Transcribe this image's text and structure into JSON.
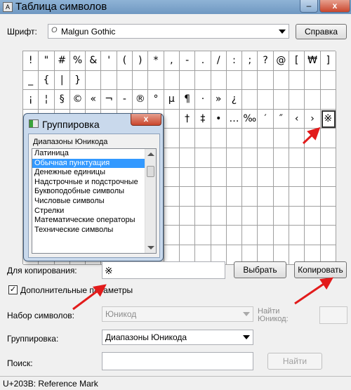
{
  "window": {
    "title": "Таблица символов",
    "minimize_label": "–",
    "close_label": "x"
  },
  "font_row": {
    "label": "Шрифт:",
    "font_icon": "O",
    "value": "Malgun Gothic",
    "help_button": "Справка"
  },
  "grid_rows": [
    [
      "!",
      "\"",
      "#",
      "%",
      "&",
      "'",
      "(",
      ")",
      "*",
      ",",
      "-",
      ".",
      "/",
      ":",
      ";",
      "?",
      "@",
      "[",
      "₩",
      "]"
    ],
    [
      "_",
      "{",
      "|",
      "}",
      "",
      "",
      "",
      "",
      "",
      "",
      "",
      "",
      "",
      "",
      "",
      "",
      "",
      "",
      "",
      ""
    ],
    [
      "¡",
      "¦",
      "§",
      "©",
      "«",
      "¬",
      "-",
      "®",
      "°",
      "µ",
      "¶",
      "·",
      "»",
      "¿",
      "",
      "",
      "",
      "",
      "",
      ""
    ],
    [
      "",
      "",
      "",
      "",
      "",
      "",
      "",
      "",
      "",
      "",
      "†",
      "‡",
      "•",
      "…",
      "‰",
      "′",
      "″",
      "‹",
      "›",
      "※"
    ],
    [
      "",
      "",
      "",
      "",
      "",
      "",
      "",
      "",
      "",
      "",
      "",
      "",
      "",
      "",
      "",
      "",
      "",
      "",
      "",
      ""
    ],
    [
      "",
      "",
      "",
      "",
      "",
      "",
      "",
      "",
      "",
      "",
      "",
      "",
      "",
      "",
      "",
      "",
      "",
      "",
      "",
      ""
    ],
    [
      "",
      "",
      "",
      "",
      "",
      "",
      "",
      "",
      "",
      "",
      "",
      "",
      "",
      "",
      "",
      "",
      "",
      "",
      "",
      ""
    ],
    [
      "",
      "",
      "",
      "",
      "",
      "",
      "",
      "",
      "",
      "",
      "",
      "",
      "",
      "",
      "",
      "",
      "",
      "",
      "",
      ""
    ],
    [
      "",
      "",
      "",
      "",
      "",
      "",
      "",
      "",
      "",
      "",
      "",
      "",
      "",
      "",
      "",
      "",
      "",
      "",
      "",
      ""
    ],
    [
      "",
      "",
      "",
      "",
      "",
      "",
      "",
      "",
      "",
      "",
      "",
      "",
      "",
      "",
      "",
      "",
      "",
      "",
      "",
      ""
    ],
    [
      "",
      "",
      "",
      "",
      "",
      "",
      "",
      "",
      "",
      "",
      "",
      "",
      "",
      "",
      "",
      "",
      "",
      "",
      "",
      ""
    ]
  ],
  "grouping_popup": {
    "title": "Группировка",
    "close_label": "x",
    "list_header": "Диапазоны Юникода",
    "items": [
      "Латиница",
      "Обычная пунктуация",
      "Денежные единицы",
      "Надстрочные и подстрочные",
      "Буквоподобные символы",
      "Числовые символы",
      "Стрелки",
      "Математические операторы",
      "Технические символы"
    ],
    "selected_index": 1
  },
  "copy_row": {
    "label": "Для копирования:",
    "value": "※",
    "select_button": "Выбрать",
    "copy_button": "Копировать"
  },
  "advanced": {
    "checkbox_label": "Дополнительные параметры",
    "checked": true,
    "check_mark": "✓"
  },
  "charset": {
    "label": "Набор символов:",
    "value": "Юникод",
    "goto_label": "Найти\nЮникод:"
  },
  "grouping": {
    "label": "Группировка:",
    "value": "Диапазоны Юникода"
  },
  "search": {
    "label": "Поиск:",
    "value": "",
    "find_button": "Найти"
  },
  "status": {
    "text": "U+203B: Reference Mark"
  },
  "colors": {
    "annotation_arrow": "#e21b1b",
    "selection": "#3399ff"
  }
}
